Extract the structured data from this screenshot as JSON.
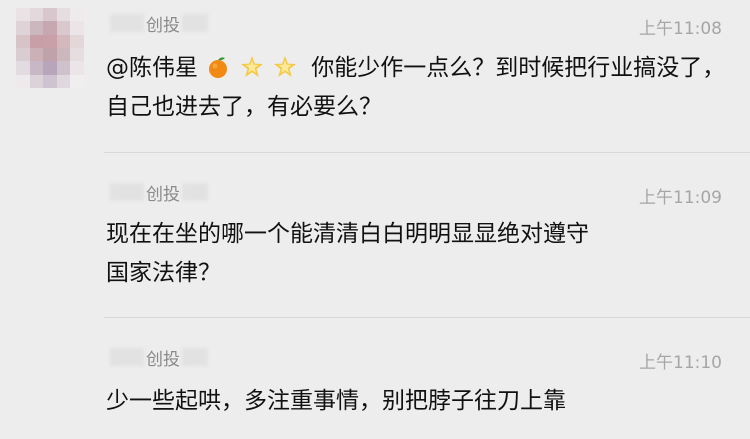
{
  "messages": [
    {
      "sender_visible": "创投",
      "time": "上午11:08",
      "mention": "@陈伟星",
      "emoji_icons": [
        "tangerine-icon",
        "glowing-star-icon",
        "glowing-star-icon"
      ],
      "text": "你能少作一点么？到时候把行业搞没了，自己也进去了，有必要么？"
    },
    {
      "sender_visible": "创投",
      "time": "上午11:09",
      "text": "现在在坐的哪一个能清清白白明明显显绝对遵守国家法律？"
    },
    {
      "sender_visible": "创投",
      "time": "上午11:10",
      "text": "少一些起哄，多注重事情，别把脖子往刀上靠"
    }
  ],
  "colors": {
    "background": "#ededed",
    "time": "#a6a6a6",
    "text": "#111111",
    "divider": "#d9d9d9"
  }
}
